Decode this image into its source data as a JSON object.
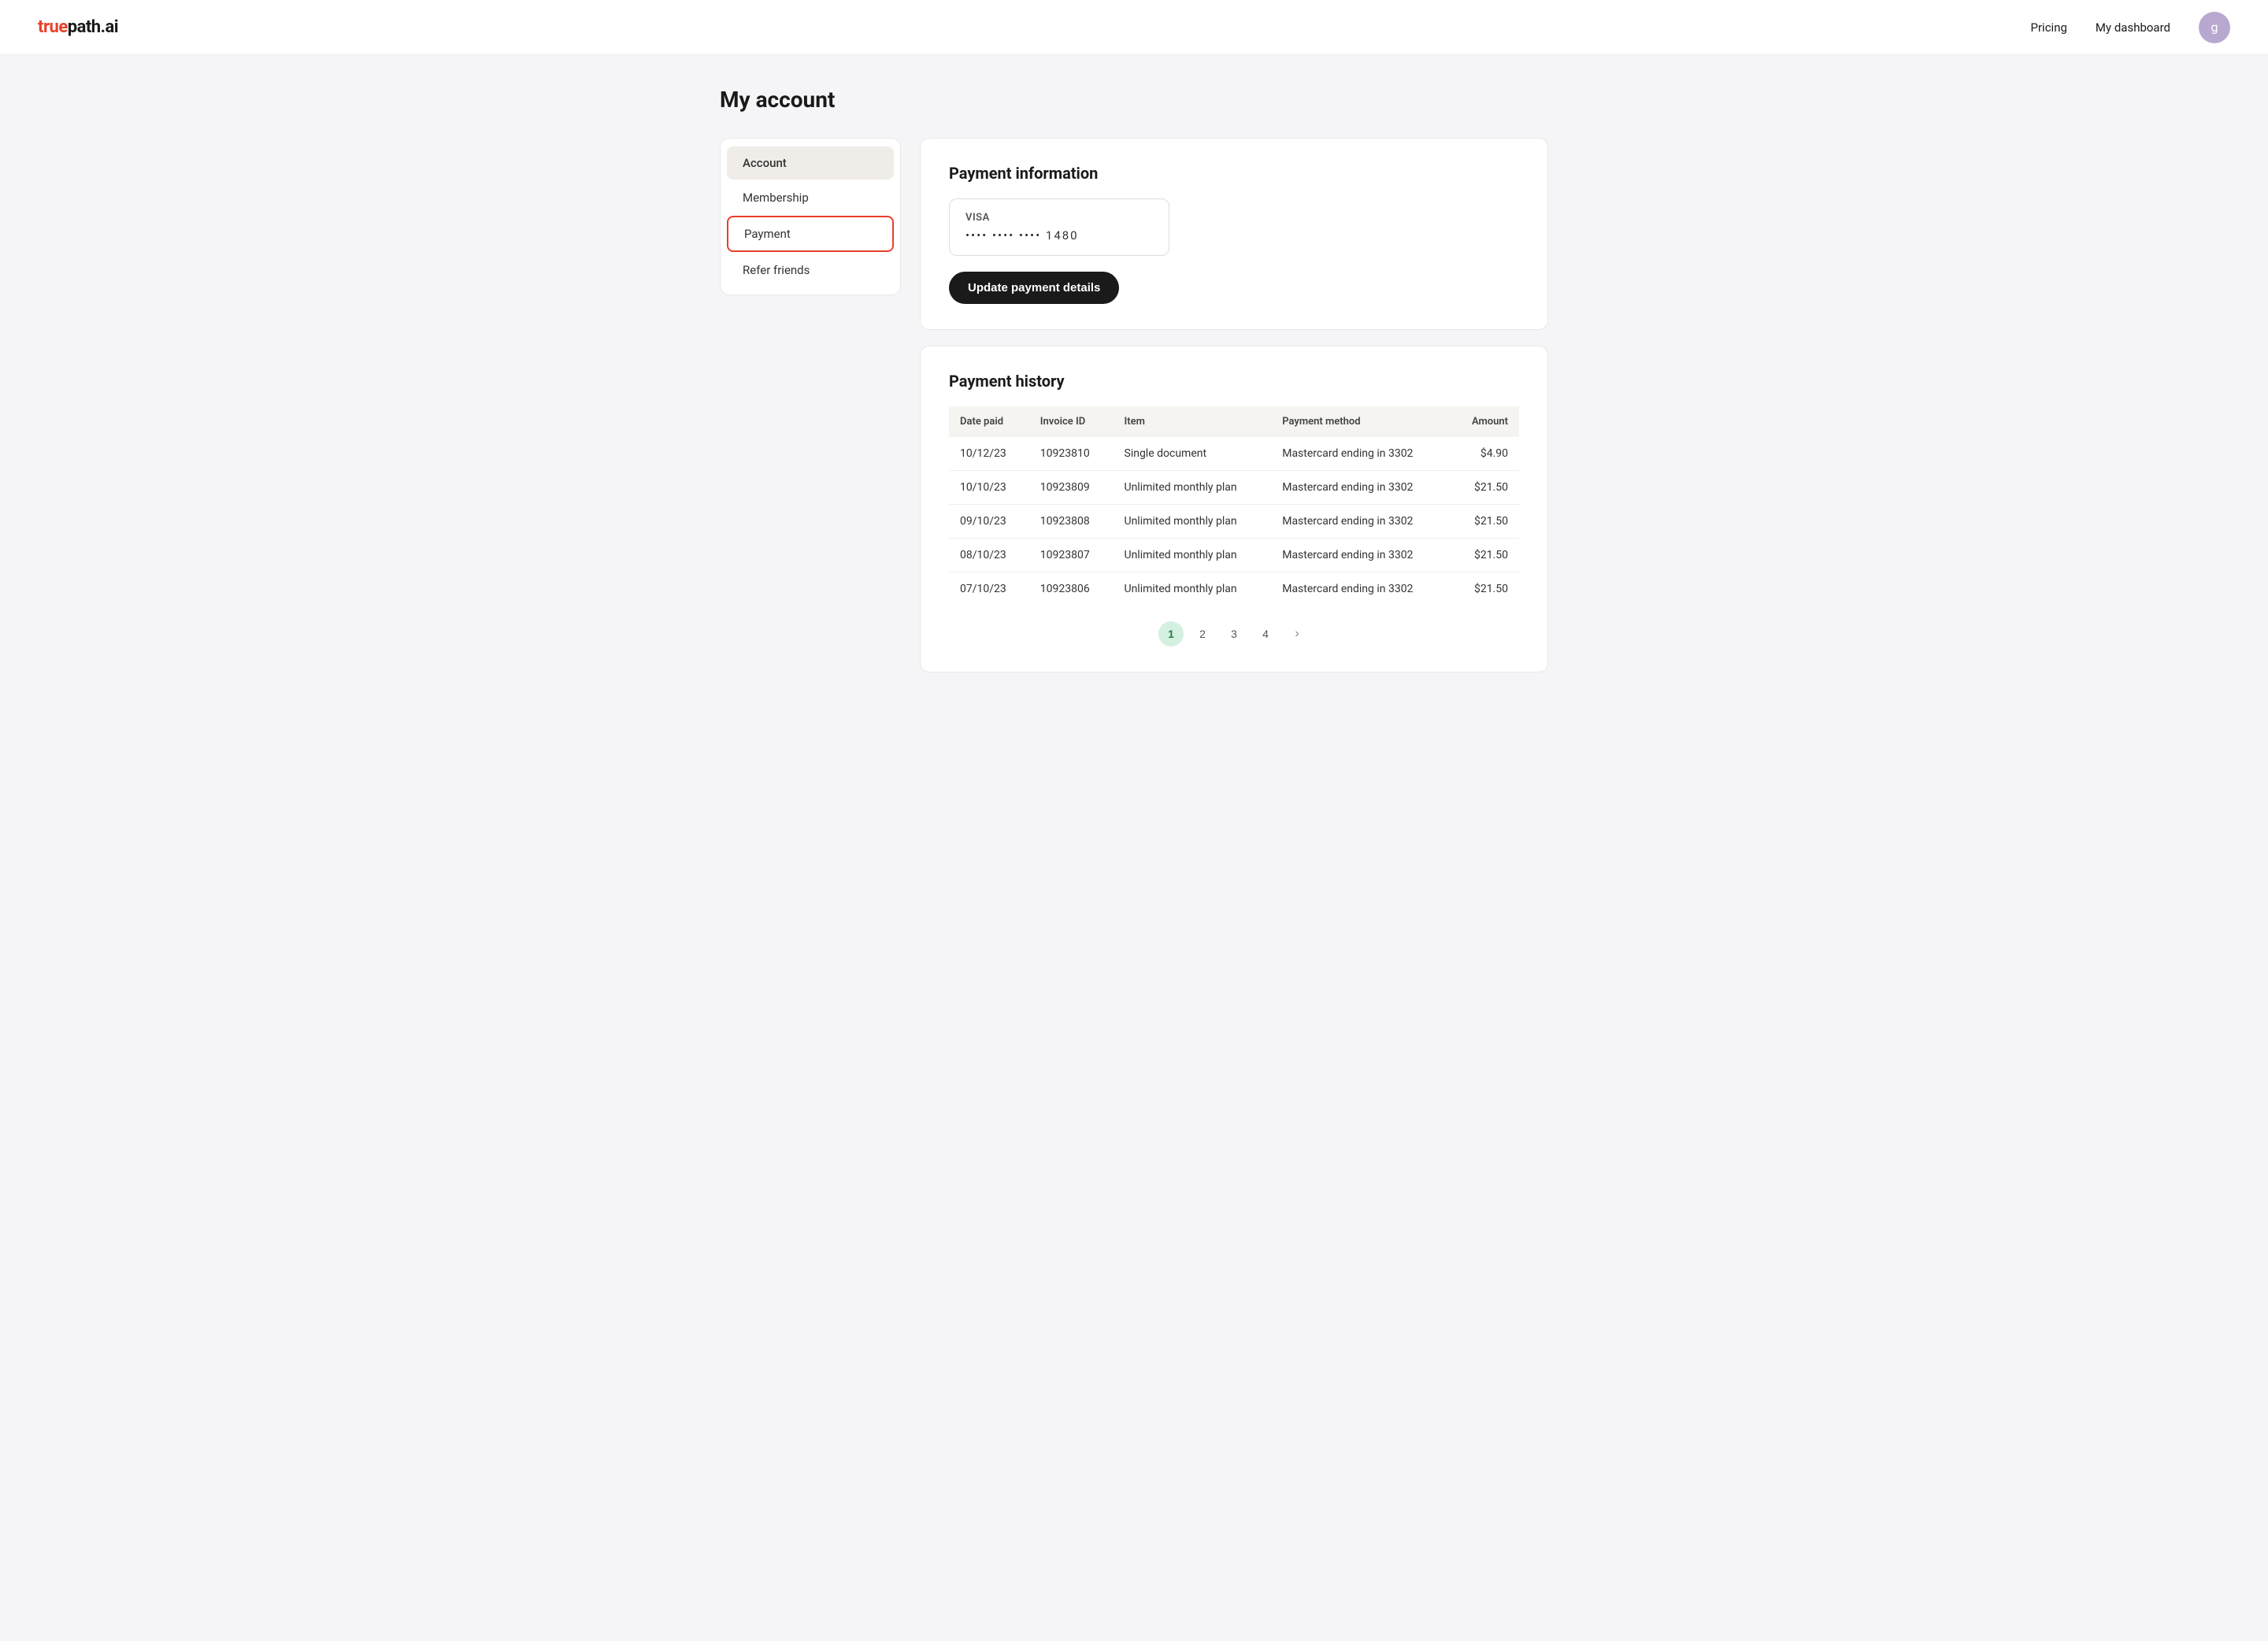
{
  "brand": {
    "logo_true": "true",
    "logo_path": "path.ai"
  },
  "header": {
    "pricing_label": "Pricing",
    "dashboard_label": "My dashboard",
    "avatar_icon": "g"
  },
  "page": {
    "title": "My account"
  },
  "sidebar": {
    "items": [
      {
        "id": "account",
        "label": "Account",
        "state": "active"
      },
      {
        "id": "membership",
        "label": "Membership",
        "state": "normal"
      },
      {
        "id": "payment",
        "label": "Payment",
        "state": "selected"
      },
      {
        "id": "refer",
        "label": "Refer friends",
        "state": "normal"
      }
    ]
  },
  "payment_info": {
    "title": "Payment information",
    "card_brand": "VISA",
    "card_number": "•••• •••• •••• 1480",
    "update_button": "Update payment details"
  },
  "payment_history": {
    "title": "Payment history",
    "columns": [
      "Date paid",
      "Invoice ID",
      "Item",
      "Payment method",
      "Amount"
    ],
    "rows": [
      {
        "date": "10/12/23",
        "invoice": "10923810",
        "item": "Single document",
        "method": "Mastercard ending in 3302",
        "amount": "$4.90"
      },
      {
        "date": "10/10/23",
        "invoice": "10923809",
        "item": "Unlimited monthly plan",
        "method": "Mastercard ending in 3302",
        "amount": "$21.50"
      },
      {
        "date": "09/10/23",
        "invoice": "10923808",
        "item": "Unlimited monthly plan",
        "method": "Mastercard ending in 3302",
        "amount": "$21.50"
      },
      {
        "date": "08/10/23",
        "invoice": "10923807",
        "item": "Unlimited monthly plan",
        "method": "Mastercard ending in 3302",
        "amount": "$21.50"
      },
      {
        "date": "07/10/23",
        "invoice": "10923806",
        "item": "Unlimited monthly plan",
        "method": "Mastercard ending in 3302",
        "amount": "$21.50"
      }
    ],
    "pagination": [
      "1",
      "2",
      "3",
      "4",
      "›"
    ]
  }
}
